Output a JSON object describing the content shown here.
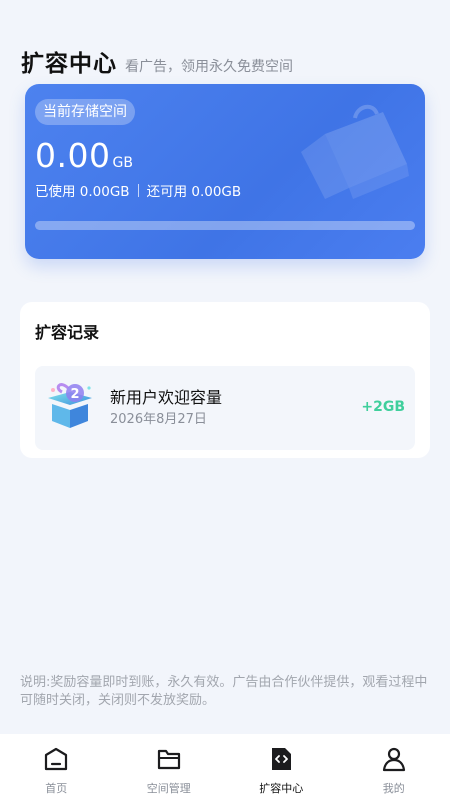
{
  "header": {
    "title": "扩容中心",
    "subtitle": "看广告，领用永久免费空间"
  },
  "storage": {
    "badge": "当前存储空间",
    "total_value": "0.00",
    "total_unit": "GB",
    "used_text": "已使用 0.00GB",
    "available_text": "还可用 0.00GB",
    "used_fraction": 0,
    "colors": {
      "card": "#4479ea",
      "progress_track": "#8fb0f4"
    }
  },
  "records": {
    "title": "扩容记录",
    "items": [
      {
        "name": "新用户欢迎容量",
        "date": "2026年8月27日",
        "amount": "+2GB",
        "icon": "gift-box-icon"
      }
    ],
    "colors": {
      "amount": "#3fcf9c"
    }
  },
  "note": "说明:奖励容量即时到账，永久有效。广告由合作伙伴提供，观看过程中可随时关闭，关闭则不发放奖励。",
  "tabbar": {
    "tabs": [
      {
        "label": "首页",
        "icon": "home-icon",
        "active": false
      },
      {
        "label": "空间管理",
        "icon": "folder-icon",
        "active": false
      },
      {
        "label": "扩容中心",
        "icon": "expand-file-icon",
        "active": true
      },
      {
        "label": "我的",
        "icon": "user-icon",
        "active": false
      }
    ]
  }
}
